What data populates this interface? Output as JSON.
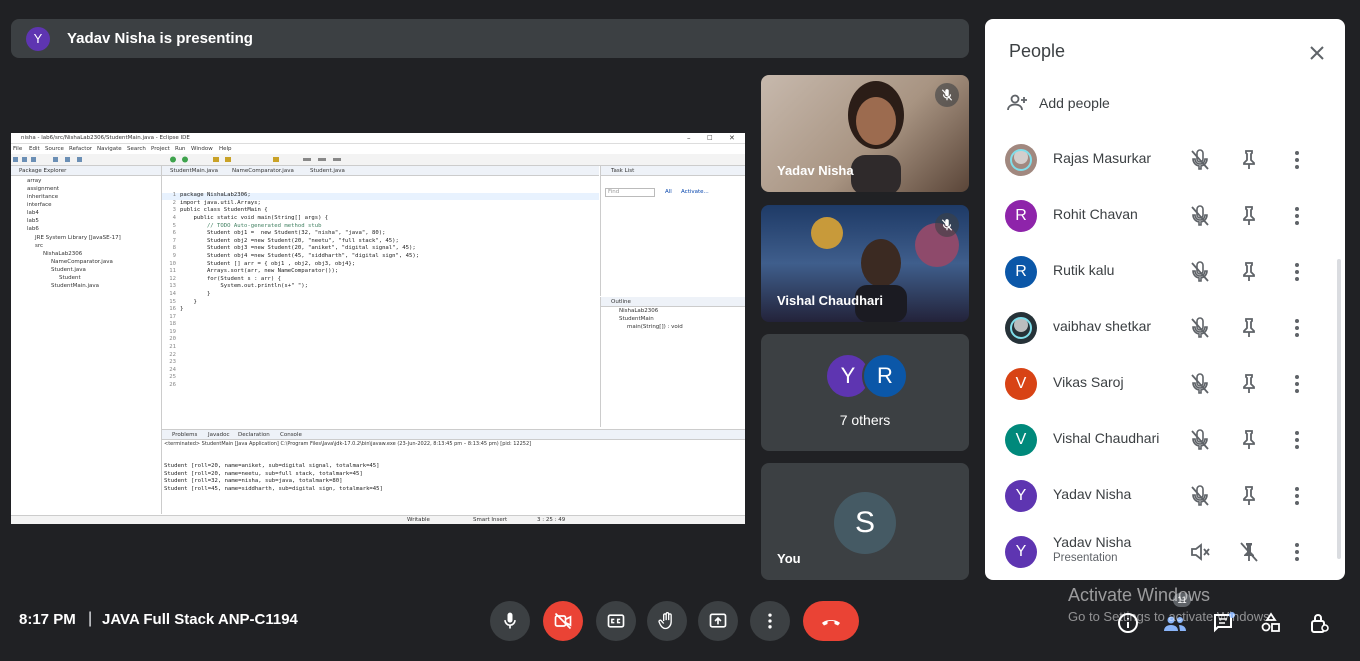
{
  "banner": {
    "avatar_letter": "Y",
    "text": "Yadav Nisha is presenting"
  },
  "shared_screen": {
    "window_title": "nisha - lab6/src/NishaLab2306/StudentMain.java - Eclipse IDE",
    "menu": [
      "File",
      "Edit",
      "Source",
      "Refactor",
      "Navigate",
      "Search",
      "Project",
      "Run",
      "Window",
      "Help"
    ],
    "package_explorer": {
      "title": "Package Explorer",
      "items": [
        "array",
        "assignment",
        "inheritance",
        "interface",
        "lab4",
        "lab5",
        "lab6",
        "JRE System Library [JavaSE-17]",
        "src",
        "NishaLab2306",
        "NameComparator.java",
        "Student.java",
        "Student",
        "StudentMain.java"
      ]
    },
    "editor_tabs": [
      "StudentMain.java",
      "NameComparator.java",
      "Student.java"
    ],
    "line_numbers": [
      "1",
      "2",
      "3",
      "4",
      "5",
      "6",
      "7",
      "8",
      "9",
      "10",
      "11",
      "12",
      "13",
      "14",
      "15",
      "16",
      "17",
      "18",
      "19",
      "20",
      "21",
      "22",
      "23",
      "24",
      "25",
      "26"
    ],
    "code_lines": [
      "package NishaLab2306;",
      "",
      "import java.util.Arrays;",
      "",
      "",
      "public class StudentMain {",
      "",
      "    public static void main(String[] args) {",
      "        // TODO Auto-generated method stub",
      "        Student obj1 =  new Student(32, \"nisha\", \"java\", 80);",
      "        Student obj2 =new Student(20, \"neetu\", \"full stack\", 45);",
      "        Student obj3 =new Student(20, \"aniket\", \"digital signal\", 45);",
      "        Student obj4 =new Student(45, \"siddharth\", \"digital sign\", 45);",
      "",
      "",
      "        Student [] arr = { obj1 , obj2, obj3, obj4};",
      "",
      "        Arrays.sort(arr, new NameComparator());",
      "",
      "        for(Student s : arr) {",
      "            System.out.println(s+\" \");",
      "        }",
      "",
      "    }",
      "",
      "}"
    ],
    "task_list": {
      "title": "Task List",
      "find_placeholder": "Find",
      "all": "All",
      "activate": "Activate..."
    },
    "outline": {
      "title": "Outline",
      "items": [
        "NishaLab2306",
        "StudentMain",
        "main(String[]) : void"
      ]
    },
    "bottom_tabs": [
      "Problems",
      "Javadoc",
      "Declaration",
      "Console"
    ],
    "console_header": "<terminated> StudentMain [Java Application] C:\\Program Files\\Java\\jdk-17.0.2\\bin\\javaw.exe  (23-Jun-2022, 8:13:45 pm – 8:13:45 pm) [pid: 12252]",
    "console_lines": [
      "Student [roll=20, name=aniket, sub=digital signal, totalmark=45]",
      "Student [roll=20, name=neetu, sub=full stack, totalmark=45]",
      "Student [roll=32, name=nisha, sub=java, totalmark=80]",
      "Student [roll=45, name=siddharth, sub=digital sign, totalmark=45]"
    ],
    "status": {
      "writable": "Writable",
      "insert_mode": "Smart Insert",
      "position": "3 : 25 : 49"
    }
  },
  "tiles": [
    {
      "name": "Yadav Nisha",
      "muted": true
    },
    {
      "name": "Vishal Chaudhari",
      "muted": true
    },
    {
      "others_label": "7 others",
      "avatars": [
        {
          "letter": "Y",
          "color": "#5e35b1"
        },
        {
          "letter": "R",
          "color": "#0b57a8"
        }
      ]
    },
    {
      "name": "You",
      "avatar_letter": "S",
      "avatar_color": "#455a64"
    }
  ],
  "people_panel": {
    "title": "People",
    "close_icon": "close-icon",
    "add_people_label": "Add people",
    "participants": [
      {
        "name": "Rajas Masurkar",
        "avatar": "",
        "color": "#a1887f",
        "photo": true
      },
      {
        "name": "Rohit Chavan",
        "avatar": "R",
        "color": "#8e24aa"
      },
      {
        "name": "Rutik kalu",
        "avatar": "R",
        "color": "#0b57a8"
      },
      {
        "name": "vaibhav shetkar",
        "avatar": "",
        "color": "#263238",
        "photo": true
      },
      {
        "name": "Vikas Saroj",
        "avatar": "V",
        "color": "#d84315"
      },
      {
        "name": "Vishal Chaudhari",
        "avatar": "V",
        "color": "#00897b"
      },
      {
        "name": "Yadav Nisha",
        "avatar": "Y",
        "color": "#5e35b1"
      },
      {
        "name": "Yadav Nisha",
        "sub": "Presentation",
        "avatar": "Y",
        "color": "#5e35b1"
      }
    ]
  },
  "bottom_bar": {
    "time": "8:17 PM",
    "separator": "|",
    "meeting_title": "JAVA Full Stack ANP-C1194",
    "people_count": "11"
  },
  "watermark": {
    "line1": "Activate Windows",
    "line2": "Go to Settings to activate Windows."
  }
}
